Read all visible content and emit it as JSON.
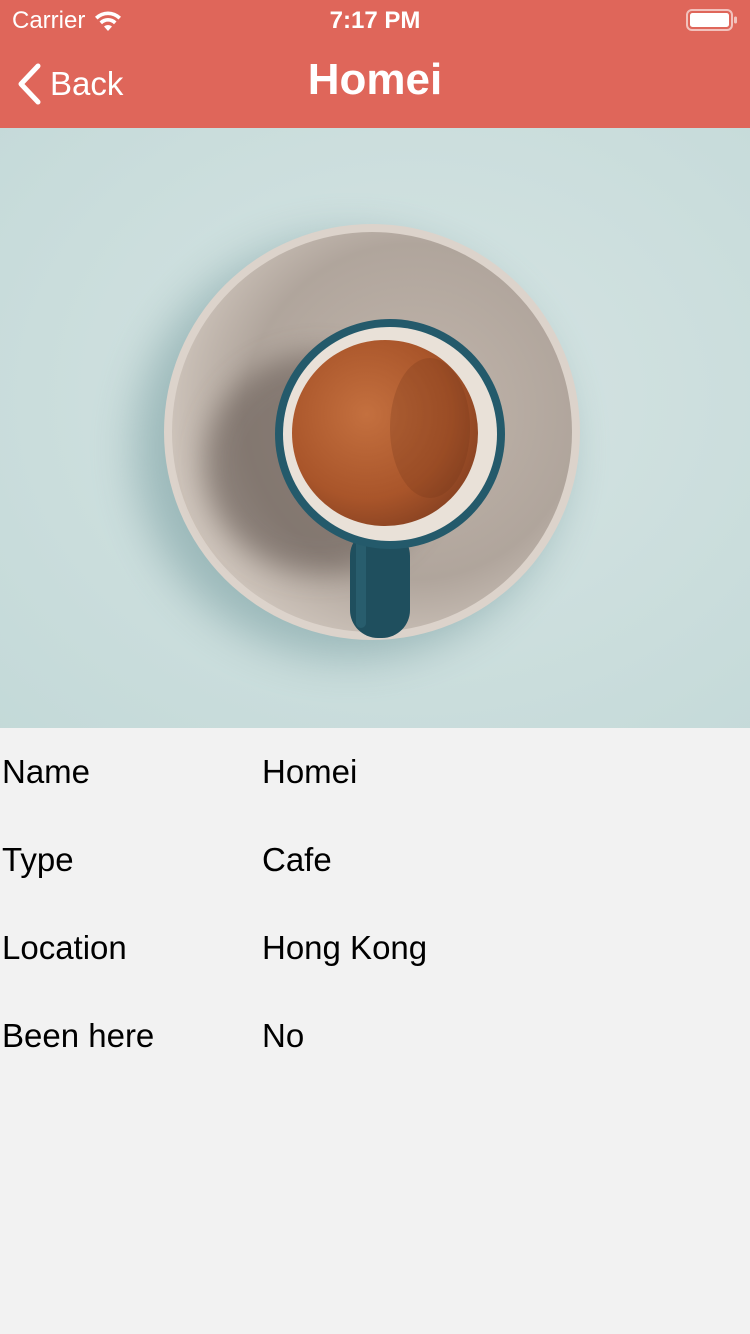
{
  "status_bar": {
    "carrier": "Carrier",
    "time": "7:17 PM",
    "wifi_icon": "wifi-icon",
    "battery_icon": "battery-icon"
  },
  "nav": {
    "back_label": "Back",
    "back_icon": "chevron-left-icon",
    "title": "Homei"
  },
  "hero": {
    "image": "coffee-cup-photo"
  },
  "details": {
    "rows": [
      {
        "label": "Name",
        "value": "Homei"
      },
      {
        "label": "Type",
        "value": "Cafe"
      },
      {
        "label": "Location",
        "value": "Hong Kong"
      },
      {
        "label": "Been here",
        "value": "No"
      }
    ]
  },
  "colors": {
    "nav_background": "#df665a",
    "nav_text": "#ffffff",
    "page_background": "#f2f2f2"
  }
}
